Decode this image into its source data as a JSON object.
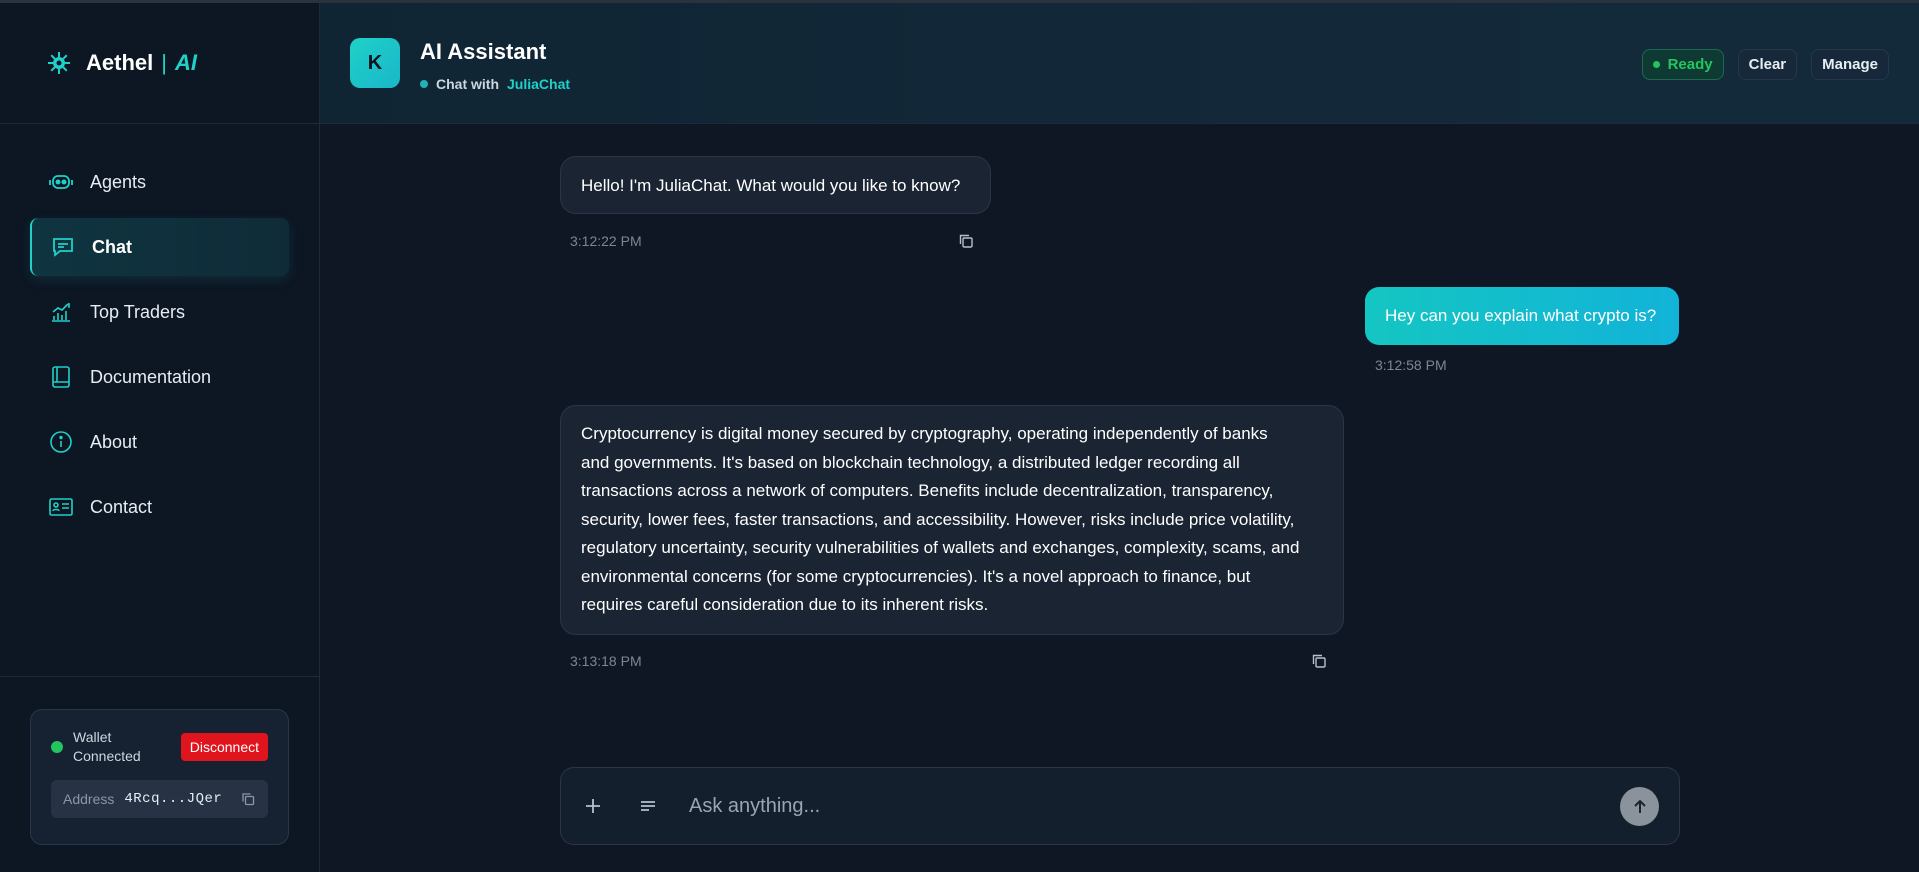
{
  "brand": {
    "name": "Aethel",
    "separator": "|",
    "suffix": "AI"
  },
  "sidebar": {
    "items": [
      {
        "label": "Agents",
        "icon": "robot-icon",
        "active": false
      },
      {
        "label": "Chat",
        "icon": "chat-icon",
        "active": true
      },
      {
        "label": "Top Traders",
        "icon": "chart-icon",
        "active": false
      },
      {
        "label": "Documentation",
        "icon": "book-icon",
        "active": false
      },
      {
        "label": "About",
        "icon": "info-icon",
        "active": false
      },
      {
        "label": "Contact",
        "icon": "contact-card-icon",
        "active": false
      }
    ]
  },
  "wallet": {
    "status": "Wallet Connected",
    "disconnect_label": "Disconnect",
    "address_label": "Address",
    "address_value": "4Rcq...JQer"
  },
  "header": {
    "avatar_letter": "K",
    "title": "AI Assistant",
    "subtitle_prefix": "Chat with",
    "agent_name": "JuliaChat",
    "status_label": "Ready",
    "clear_label": "Clear",
    "manage_label": "Manage"
  },
  "messages": [
    {
      "role": "assistant",
      "text": "Hello! I'm JuliaChat. What would you like to know?",
      "time": "3:12:22 PM"
    },
    {
      "role": "user",
      "text": "Hey can you explain what crypto is?",
      "time": "3:12:58 PM"
    },
    {
      "role": "assistant",
      "lines": [
        "Cryptocurrency is digital money secured by cryptography, operating independently of banks",
        "and governments. It's based on blockchain technology, a distributed ledger recording all",
        "transactions across a network of computers.  Benefits include decentralization, transparency,",
        "security, lower fees, faster transactions, and accessibility. However, risks include price volatility,",
        "regulatory uncertainty, security vulnerabilities of wallets and exchanges, complexity, scams, and",
        "environmental concerns (for some cryptocurrencies).  It's a novel approach to finance, but",
        "requires careful consideration due to its inherent risks."
      ],
      "time": "3:13:18 PM"
    }
  ],
  "composer": {
    "placeholder": "Ask anything..."
  },
  "colors": {
    "accent": "#1fd1c8",
    "ready": "#22c55e",
    "danger": "#e0141c",
    "background": "#0f1724"
  }
}
